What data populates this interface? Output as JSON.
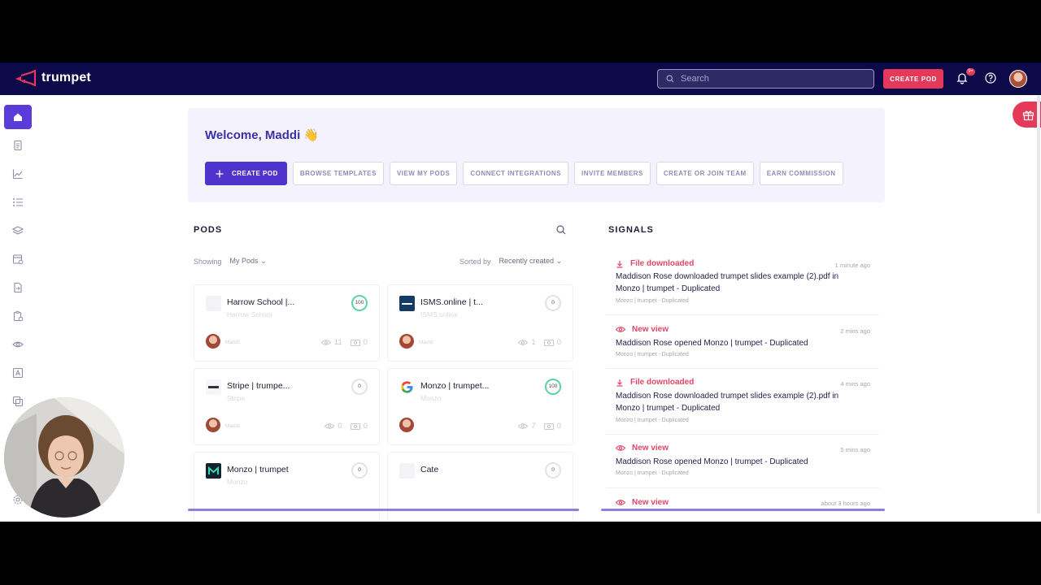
{
  "app": {
    "brand": "trumpet",
    "accent": "#e5395a",
    "nav_bg": "#0d0a4a",
    "primary": "#4e34cc"
  },
  "topbar": {
    "search_placeholder": "Search",
    "create_pod": "CREATE POD",
    "notification_badge": "9+"
  },
  "sidebar": {
    "items": [
      "home-icon",
      "document-icon",
      "chart-line-icon",
      "list-icon",
      "layers-icon",
      "calendar-settings-icon",
      "file-export-icon",
      "clipboard-check-icon",
      "eye-icon",
      "text-box-icon",
      "copy-icon",
      "settings-icon"
    ]
  },
  "welcome": {
    "title": "Welcome, Maddi 👋",
    "actions": [
      "CREATE POD",
      "BROWSE TEMPLATES",
      "VIEW MY PODS",
      "CONNECT INTEGRATIONS",
      "INVITE MEMBERS",
      "CREATE OR JOIN TEAM",
      "EARN COMMISSION"
    ]
  },
  "pods": {
    "title": "PODS",
    "showing_label": "Showing",
    "showing_value": "My Pods",
    "sorted_label": "Sorted by",
    "sorted_value": "Recently created",
    "cards": [
      {
        "name": "Harrow School |...",
        "sub": "Harrow School",
        "score": "100",
        "owner": "Maddi",
        "views": "11",
        "engagement": "0"
      },
      {
        "name": "ISMS.online | t...",
        "sub": "ISMS.online",
        "score": "0",
        "owner": "Maddi",
        "views": "1",
        "engagement": "0"
      },
      {
        "name": "Stripe | trumpe...",
        "sub": "Stripe",
        "score": "0",
        "owner": "Maddi",
        "views": "0",
        "engagement": "0"
      },
      {
        "name": "Monzo | trumpet...",
        "sub": "Monzo",
        "score": "100",
        "owner": "Maddi",
        "views": "7",
        "engagement": "0"
      },
      {
        "name": "Monzo | trumpet",
        "sub": "Monzo",
        "score": "0"
      },
      {
        "name": "Cate",
        "sub": "",
        "score": "0"
      }
    ]
  },
  "signals": {
    "title": "SIGNALS",
    "items": [
      {
        "type": "File downloaded",
        "time": "1 minute ago",
        "body": "Maddison Rose downloaded trumpet slides example (2).pdf in Monzo | trumpet - Duplicated",
        "meta": "Monzo | trumpet - Duplicated"
      },
      {
        "type": "New view",
        "time": "2 mins ago",
        "body": "Maddison Rose opened Monzo | trumpet - Duplicated",
        "meta": "Monzo | trumpet - Duplicated"
      },
      {
        "type": "File downloaded",
        "time": "4 mins ago",
        "body": "Maddison Rose downloaded trumpet slides example (2).pdf in Monzo | trumpet - Duplicated",
        "meta": "Monzo | trumpet - Duplicated"
      },
      {
        "type": "New view",
        "time": "5 mins ago",
        "body": "Maddison Rose opened Monzo | trumpet - Duplicated",
        "meta": "Monzo | trumpet - Duplicated"
      },
      {
        "type": "New view",
        "time": "about 3 hours ago"
      }
    ]
  }
}
